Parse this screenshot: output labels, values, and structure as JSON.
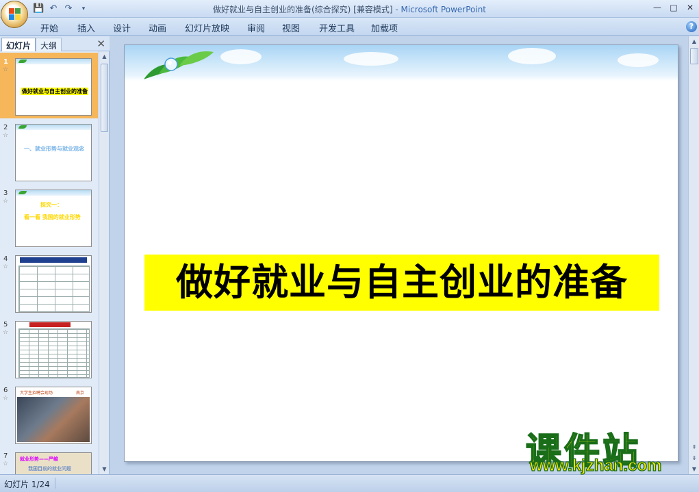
{
  "window": {
    "title": "做好就业与自主创业的准备(综合探究) [兼容模式]",
    "app_name": "- Microsoft PowerPoint"
  },
  "quick_access": {
    "icons": [
      "save-icon",
      "undo-icon",
      "redo-icon",
      "customize-icon"
    ]
  },
  "window_controls": [
    "minimize",
    "maximize",
    "close"
  ],
  "ribbon_tabs": [
    "开始",
    "插入",
    "设计",
    "动画",
    "幻灯片放映",
    "审阅",
    "视图",
    "开发工具",
    "加载项"
  ],
  "panel": {
    "tab_slides": "幻灯片",
    "tab_outline": "大纲",
    "close": "✕"
  },
  "thumbnails": [
    {
      "num": "1",
      "text": "做好就业与自主创业的准备",
      "selected": true
    },
    {
      "num": "2",
      "text": "一、就业形势与就业观念"
    },
    {
      "num": "3",
      "text_a": "探究一：",
      "text_b": "看一看  我国的就业形势"
    },
    {
      "num": "4"
    },
    {
      "num": "5"
    },
    {
      "num": "6",
      "text_a": "大学生招聘会现场",
      "text_b": "南京"
    },
    {
      "num": "7",
      "text_a": "就业形势——严峻",
      "text_b": "我国目前的就业问题"
    }
  ],
  "slide": {
    "title": "做好就业与自主创业的准备"
  },
  "watermark": {
    "cn": "课件站",
    "url": "www.kjzhan.com"
  },
  "status": {
    "slide_info": "幻灯片 1/24"
  },
  "colors": {
    "title_highlight": "#ffff00",
    "selected_thumb": "#f6b65a",
    "app_name": "#3568b0"
  }
}
